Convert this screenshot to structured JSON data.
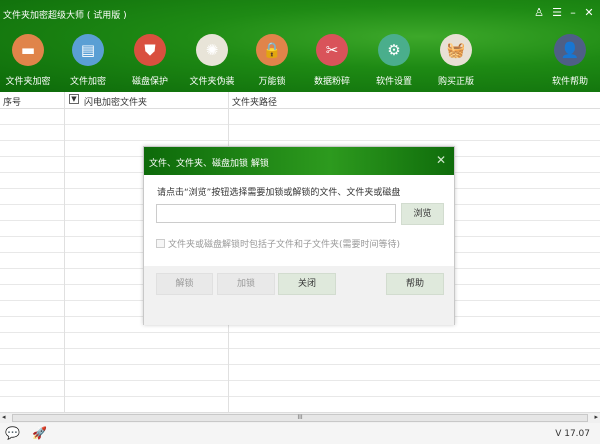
{
  "app": {
    "title": "文件夹加密超级大师 ( 试用版 )",
    "skin_icon": "shirt-icon",
    "menu_icon": "menu-icon",
    "minimize_icon": "minimize-icon",
    "close_icon": "close-icon"
  },
  "toolbar": [
    {
      "label": "文件夹加密",
      "icon": "folder-icon",
      "color": "#e0844a",
      "glyph": "▬"
    },
    {
      "label": "文件加密",
      "icon": "clipboard-icon",
      "color": "#5a9fd4",
      "glyph": "▤"
    },
    {
      "label": "磁盘保护",
      "icon": "shield-icon",
      "color": "#d9503f",
      "glyph": "⛊"
    },
    {
      "label": "文件夹伪装",
      "icon": "palette-icon",
      "color": "#e8e4d8",
      "glyph": "✺"
    },
    {
      "label": "万能锁",
      "icon": "lock-icon",
      "color": "#e0844a",
      "glyph": "🔒"
    },
    {
      "label": "数据粉碎",
      "icon": "scissors-icon",
      "color": "#d9535a",
      "glyph": "✂"
    },
    {
      "label": "软件设置",
      "icon": "gear-icon",
      "color": "#4aae8c",
      "glyph": "⚙"
    },
    {
      "label": "购买正版",
      "icon": "basket-icon",
      "color": "#e8e0d4",
      "glyph": "🧺"
    },
    {
      "label": "软件帮助",
      "icon": "user-icon",
      "color": "#4e5f86",
      "glyph": "👤"
    }
  ],
  "table": {
    "columns": [
      "序号",
      "闪电加密文件夹",
      "文件夹路径"
    ]
  },
  "dialog": {
    "title": "文件、文件夹、磁盘加锁 解锁",
    "prompt": "请点击“浏览”按钮选择需要加锁或解锁的文件、文件夹或磁盘",
    "path_value": "",
    "browse": "浏览",
    "checkbox_label": "文件夹或磁盘解锁时包括子文件和子文件夹(需要时间等待)",
    "checkbox_checked": false,
    "unlock": "解锁",
    "lock": "加锁",
    "close": "关闭",
    "help": "帮助"
  },
  "status": {
    "version": "V 17.07",
    "chat_icon": "chat-icon",
    "rocket_icon": "rocket-icon"
  },
  "scrollbar": {
    "grip": "III"
  }
}
